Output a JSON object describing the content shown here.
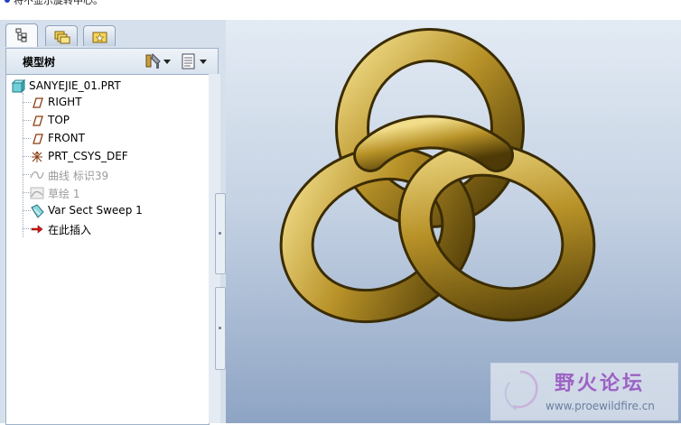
{
  "status_message": "将不显示旋转中心。",
  "panel": {
    "title": "模型树",
    "tabs": [
      {
        "icon": "model-tree-icon"
      },
      {
        "icon": "folder-browser-icon"
      },
      {
        "icon": "favorites-icon"
      }
    ],
    "header_buttons": [
      {
        "icon": "settings-icon"
      },
      {
        "icon": "show-icon"
      }
    ]
  },
  "tree": {
    "root": "SANYEJIE_01.PRT",
    "items": [
      {
        "label": "RIGHT",
        "icon": "datum-plane-icon",
        "dim": false
      },
      {
        "label": "TOP",
        "icon": "datum-plane-icon",
        "dim": false
      },
      {
        "label": "FRONT",
        "icon": "datum-plane-icon",
        "dim": false
      },
      {
        "label": "PRT_CSYS_DEF",
        "icon": "csys-icon",
        "dim": false
      },
      {
        "label": "曲线 标识39",
        "icon": "curve-icon",
        "dim": true
      },
      {
        "label": "草绘 1",
        "icon": "sketch-icon",
        "dim": true
      },
      {
        "label": "Var Sect Sweep 1",
        "icon": "sweep-icon",
        "dim": false
      },
      {
        "label": "在此插入",
        "icon": "insert-here-arrow-icon",
        "dim": false
      }
    ]
  },
  "viewport": {
    "model": "trefoil-knot",
    "model_color": "#c9a83a"
  },
  "watermark": {
    "title": "野火论坛",
    "url": "www.proewildfire.cn"
  }
}
